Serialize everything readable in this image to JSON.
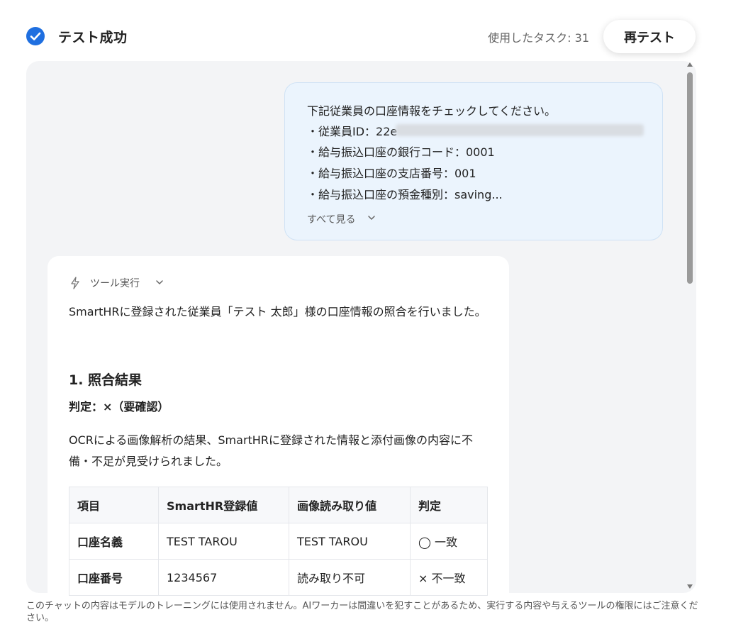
{
  "header": {
    "status_title": "テスト成功",
    "tasks_used": "使用したタスク: 31",
    "retest_label": "再テスト",
    "accent_color": "#1f6fe0"
  },
  "user_message": {
    "lines": [
      "下記従業員の口座情報をチェックしてください。",
      "・従業員ID：22e",
      "・給与振込口座の銀行コード：0001",
      "・給与振込口座の支店番号：001",
      "・給与振込口座の預金種別：saving..."
    ],
    "see_all": "すべて見る"
  },
  "ai_message": {
    "tool_label": "ツール実行",
    "intro": "SmartHRに登録された従業員「テスト 太郎」様の口座情報の照合を行いました。",
    "section_title": "1. 照合結果",
    "verdict": "判定：×（要確認）",
    "summary": "OCRによる画像解析の結果、SmartHRに登録された情報と添付画像の内容に不備・不足が見受けられました。",
    "table": {
      "headers": [
        "項目",
        "SmartHR登録値",
        "画像読み取り値",
        "判定"
      ],
      "rows": [
        [
          "口座名義",
          "TEST TAROU",
          "TEST TAROU",
          "◯ 一致"
        ],
        [
          "口座番号",
          "1234567",
          "読み取り不可",
          "× 不一致"
        ]
      ]
    }
  },
  "footer": {
    "disclaimer": "このチャットの内容はモデルのトレーニングには使用されません。AIワーカーは間違いを犯すことがあるため、実行する内容や与えるツールの権限にはご注意ください。"
  }
}
